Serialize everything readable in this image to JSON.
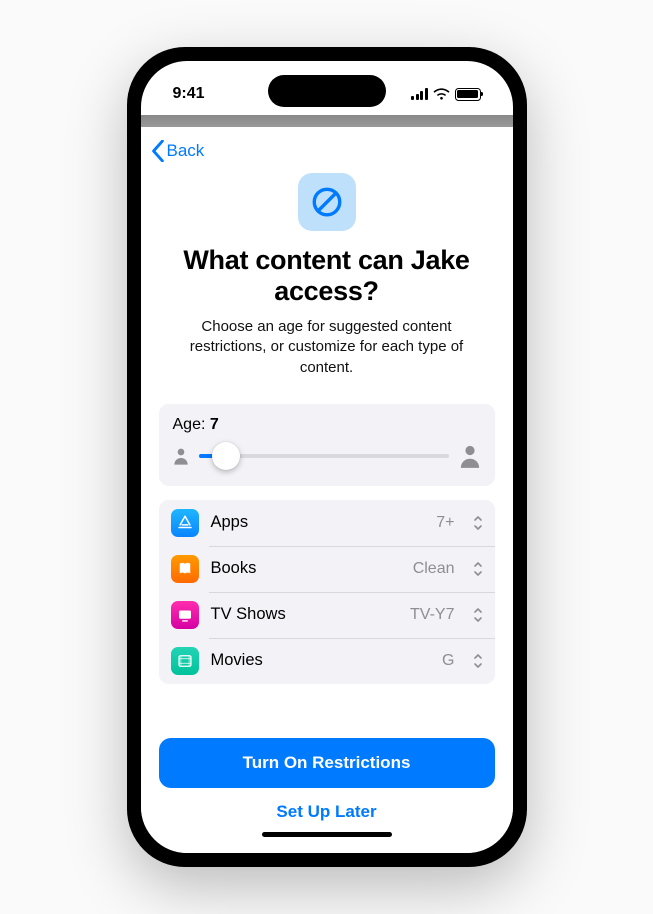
{
  "status": {
    "time": "9:41"
  },
  "nav": {
    "back_label": "Back"
  },
  "hero": {
    "title": "What content can Jake access?",
    "subtitle": "Choose an age for suggested content restrictions, or customize for each type of content."
  },
  "age": {
    "label_prefix": "Age: ",
    "value": "7",
    "min": 4,
    "max": 18,
    "percent": 11
  },
  "content_rows": [
    {
      "icon": "appstore-icon",
      "label": "Apps",
      "value": "7+"
    },
    {
      "icon": "books-icon",
      "label": "Books",
      "value": "Clean"
    },
    {
      "icon": "tv-icon",
      "label": "TV Shows",
      "value": "TV-Y7"
    },
    {
      "icon": "movies-icon",
      "label": "Movies",
      "value": "G"
    }
  ],
  "footer": {
    "primary": "Turn On Restrictions",
    "secondary": "Set Up Later"
  },
  "colors": {
    "accent": "#007aff",
    "card_bg": "#f2f2f7",
    "secondary_text": "#8e8e93"
  }
}
